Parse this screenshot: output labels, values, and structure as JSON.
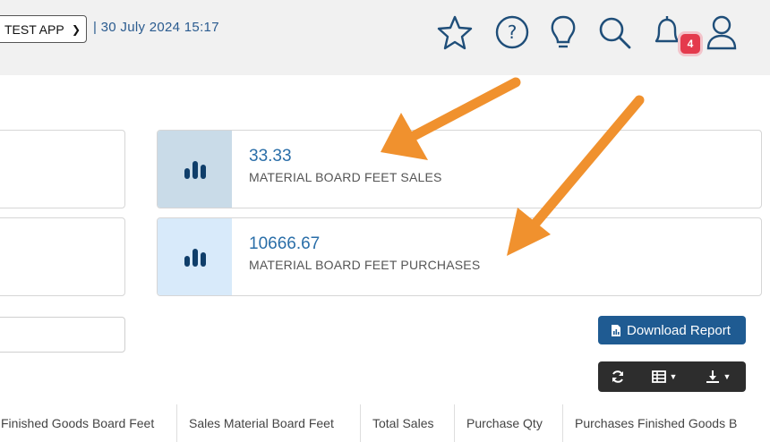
{
  "header": {
    "app_select_value": "TEST APP",
    "datetime": "| 30 July 2024 15:17",
    "icons": [
      "star-icon",
      "help-icon",
      "lightbulb-icon",
      "search-icon",
      "bell-icon",
      "user-icon"
    ],
    "notification_count": "4",
    "badge_color": "#e43a4d"
  },
  "stats": [
    {
      "value": "33.33",
      "label": "MATERIAL BOARD FEET SALES",
      "side_color": "#c9dbe8",
      "icon": "bar-chart-icon"
    },
    {
      "value": "10666.67",
      "label": "MATERIAL BOARD FEET PURCHASES",
      "side_color": "#d8eafa",
      "icon": "bar-chart-icon"
    }
  ],
  "actions": {
    "download_label": "Download Report",
    "download_color": "#1f5b92",
    "toolbar_icons": [
      "refresh-icon",
      "table-columns-icon",
      "export-icon"
    ]
  },
  "table": {
    "columns": [
      "Finished Goods Board Feet",
      "Sales Material Board Feet",
      "Total Sales",
      "Purchase Qty",
      "Purchases Finished Goods B"
    ]
  },
  "annotation_color": "#f0912e"
}
